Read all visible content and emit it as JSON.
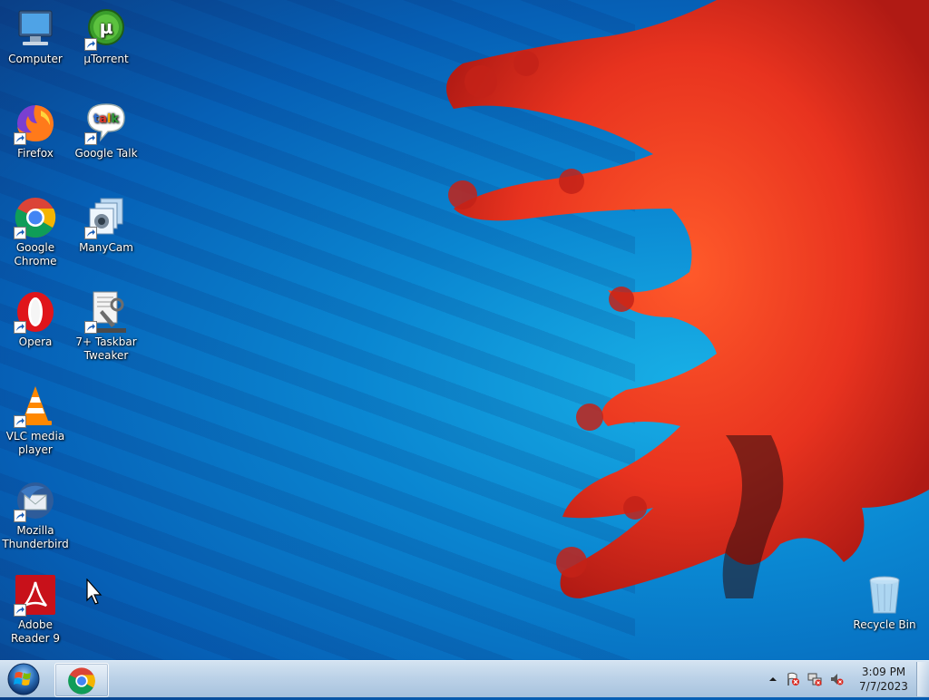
{
  "desktop": {
    "icons": [
      {
        "label": "Computer",
        "icon": "computer-icon"
      },
      {
        "label": "µTorrent",
        "icon": "utorrent-icon"
      },
      {
        "label": "Firefox",
        "icon": "firefox-icon"
      },
      {
        "label": "Google Talk",
        "icon": "google-talk-icon"
      },
      {
        "label": "Google Chrome",
        "icon": "chrome-icon"
      },
      {
        "label": "ManyCam",
        "icon": "manycam-icon"
      },
      {
        "label": "Opera",
        "icon": "opera-icon"
      },
      {
        "label": "7+ Taskbar Tweaker",
        "icon": "taskbar-tweaker-icon"
      },
      {
        "label": "VLC media player",
        "icon": "vlc-icon"
      },
      {
        "label": "Mozilla Thunderbird",
        "icon": "thunderbird-icon"
      },
      {
        "label": "Adobe Reader 9",
        "icon": "adobe-reader-icon"
      },
      {
        "label": "Recycle Bin",
        "icon": "recycle-bin-icon"
      }
    ],
    "talk_badge": "talk"
  },
  "taskbar": {
    "start_icon": "windows-start-icon",
    "pinned": [
      {
        "app": "Google Chrome",
        "icon": "chrome-icon"
      }
    ],
    "tray_icons": [
      "show-hidden-icons",
      "action-center-flag-icon",
      "network-icon",
      "volume-muted-icon"
    ],
    "clock": {
      "time": "3:09 PM",
      "date": "7/7/2023"
    }
  },
  "colors": {
    "wallpaper_blue": "#0a86d1",
    "coral_red": "#e8331f",
    "taskbar": "#bcd2e8"
  }
}
